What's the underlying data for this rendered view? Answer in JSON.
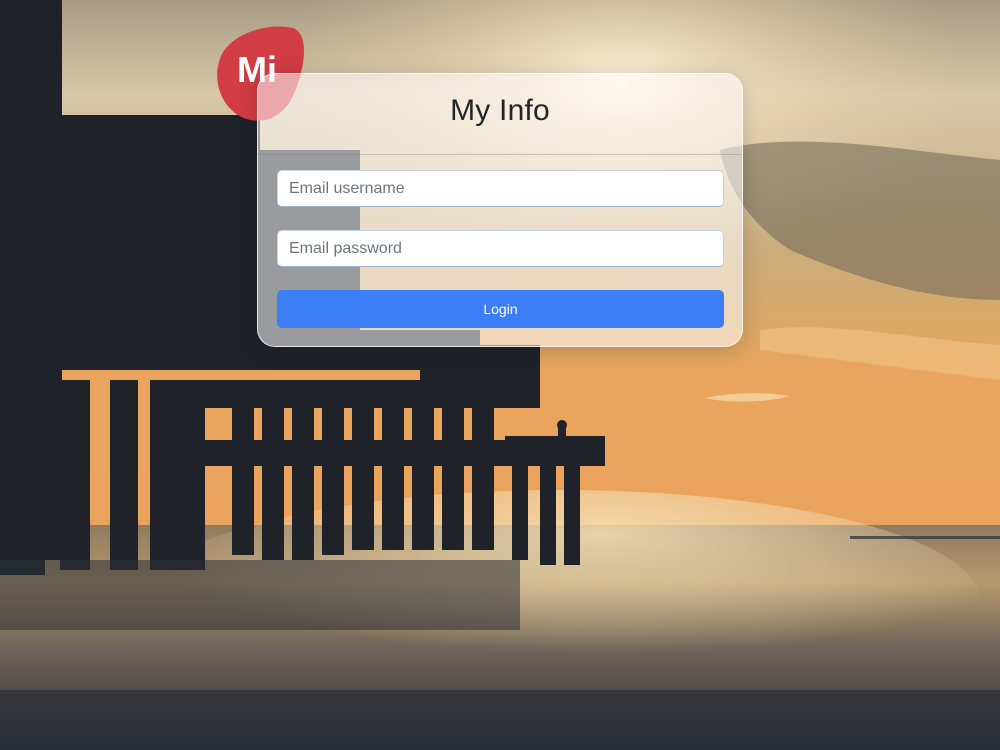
{
  "app": {
    "logo_text": "Mi",
    "logo_color": "#d23c43"
  },
  "login_card": {
    "title": "My Info",
    "username_placeholder": "Email username",
    "password_placeholder": "Email password",
    "login_label": "Login",
    "accent_color": "#3b7ef6"
  },
  "background": {
    "scene": "pier-at-sunset-photo"
  }
}
